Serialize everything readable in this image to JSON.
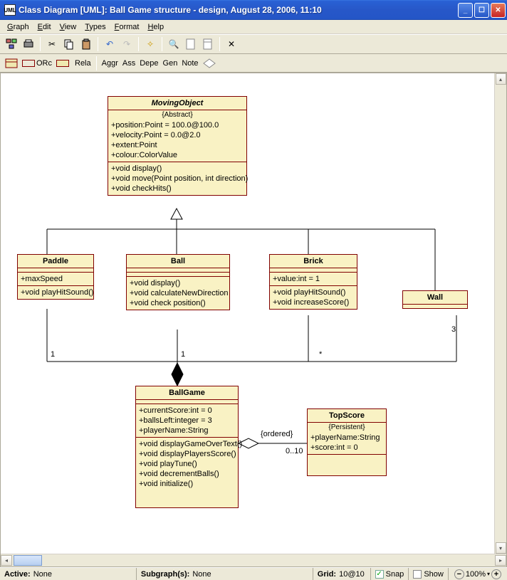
{
  "titlebar": {
    "icon_text": "UML",
    "text": "Class Diagram [UML]: Ball Game structure - design, August 28, 2006, 11:10"
  },
  "menu": [
    "Graph",
    "Edit",
    "View",
    "Types",
    "Format",
    "Help"
  ],
  "toolbar2": {
    "orc": "ORc",
    "rela": "Rela",
    "aggr": "Aggr",
    "ass": "Ass",
    "depe": "Depe",
    "gen": "Gen",
    "note": "Note"
  },
  "classes": {
    "moving": {
      "name": "MovingObject",
      "stereo": "{Abstract}",
      "attrs": [
        "+position:Point = 100.0@100.0",
        "+velocity:Point = 0.0@2.0",
        "+extent:Point",
        "+colour:ColorValue"
      ],
      "ops": [
        "+void display()",
        "+void move(Point position, int direction)",
        "+void checkHits()"
      ]
    },
    "paddle": {
      "name": "Paddle",
      "attrs": [
        "+maxSpeed"
      ],
      "ops": [
        "+void playHitSound()"
      ]
    },
    "ball": {
      "name": "Ball",
      "ops": [
        "+void display()",
        "+void calculateNewDirection",
        "+void check position()"
      ]
    },
    "brick": {
      "name": "Brick",
      "attrs": [
        "+value:int = 1"
      ],
      "ops": [
        "+void playHitSound()",
        "+void increaseScore()"
      ]
    },
    "wall": {
      "name": "Wall"
    },
    "ballgame": {
      "name": "BallGame",
      "attrs": [
        "+currentScore:int = 0",
        "+ballsLeft:integer = 3",
        "+playerName:String"
      ],
      "ops": [
        "+void displayGameOverText()",
        "+void displayPlayersScore()",
        "+void playTune()",
        "+void decrementBalls()",
        "+void initialize()"
      ]
    },
    "topscore": {
      "name": "TopScore",
      "stereo": "{Persistent}",
      "attrs": [
        "+playerName:String",
        "+score:int = 0"
      ]
    }
  },
  "connectors": {
    "ordered": "{ordered}",
    "range": "0..10",
    "paddle_mult": "1",
    "ball_mult": "1",
    "brick_mult": "*",
    "wall_mult": "3"
  },
  "status": {
    "active_label": "Active:",
    "active_val": "None",
    "subgraph_label": "Subgraph(s):",
    "subgraph_val": "None",
    "grid_label": "Grid:",
    "grid_val": "10@10",
    "snap": "Snap",
    "show": "Show",
    "zoom": "100%"
  }
}
